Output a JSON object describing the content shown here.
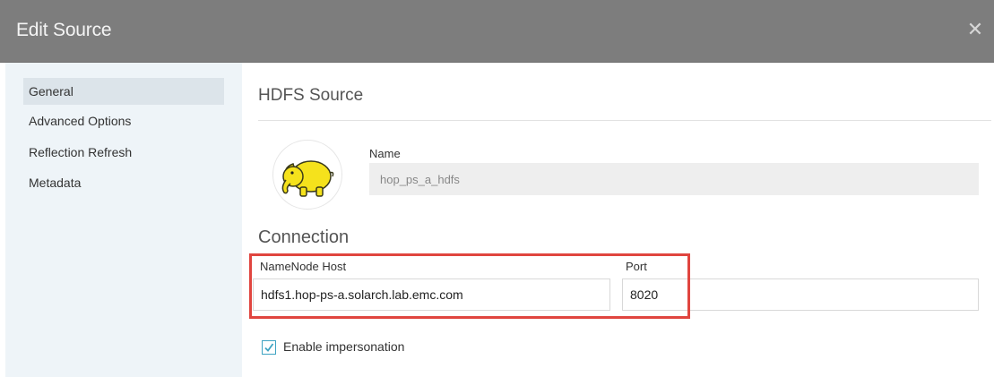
{
  "dialog": {
    "title": "Edit Source",
    "close_icon": "close-icon"
  },
  "sidebar": {
    "items": [
      {
        "label": "General",
        "active": true
      },
      {
        "label": "Advanced Options",
        "active": false
      },
      {
        "label": "Reflection Refresh",
        "active": false
      },
      {
        "label": "Metadata",
        "active": false
      }
    ]
  },
  "main": {
    "section_title": "HDFS Source",
    "logo_icon": "hadoop-elephant-icon",
    "name": {
      "label": "Name",
      "value": "hop_ps_a_hdfs"
    },
    "connection": {
      "title": "Connection",
      "namenode_host": {
        "label": "NameNode Host",
        "value": "hdfs1.hop-ps-a.solarch.lab.emc.com"
      },
      "port": {
        "label": "Port",
        "value": "8020"
      },
      "highlight_color": "#e0453f"
    },
    "impersonation": {
      "label": "Enable impersonation",
      "checked": true
    }
  },
  "colors": {
    "titlebar": "#7d7d7d",
    "sidebar": "#eef4f8",
    "accent": "#3ea3c2"
  }
}
